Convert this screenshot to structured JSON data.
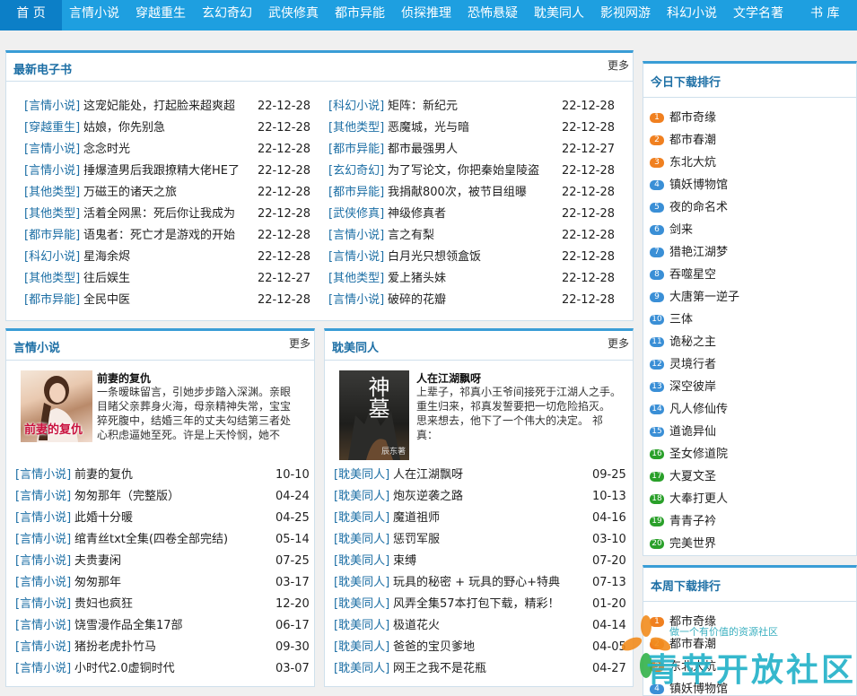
{
  "nav": {
    "items": [
      "首 页",
      "言情小说",
      "穿越重生",
      "玄幻奇幻",
      "武侠修真",
      "都市异能",
      "侦探推理",
      "恐怖悬疑",
      "耽美同人",
      "影视网游",
      "科幻小说",
      "文学名著",
      "书 库"
    ]
  },
  "latest": {
    "title": "最新电子书",
    "more": "更多",
    "left": [
      {
        "cat": "[言情小说]",
        "title": "这宠妃能处，打起脸来超爽超",
        "date": "22-12-28"
      },
      {
        "cat": "[穿越重生]",
        "title": "姑娘，你先别急",
        "date": "22-12-28"
      },
      {
        "cat": "[言情小说]",
        "title": "念念时光",
        "date": "22-12-28"
      },
      {
        "cat": "[言情小说]",
        "title": "捶爆渣男后我跟撩精大佬HE了",
        "date": "22-12-28"
      },
      {
        "cat": "[其他类型]",
        "title": "万磁王的诸天之旅",
        "date": "22-12-28"
      },
      {
        "cat": "[其他类型]",
        "title": "活着全网黑：死后你让我成为",
        "date": "22-12-28"
      },
      {
        "cat": "[都市异能]",
        "title": "语鬼者：死亡才是游戏的开始",
        "date": "22-12-28"
      },
      {
        "cat": "[科幻小说]",
        "title": "星海余烬",
        "date": "22-12-28"
      },
      {
        "cat": "[其他类型]",
        "title": "往后娱生",
        "date": "22-12-27"
      },
      {
        "cat": "[都市异能]",
        "title": "全民中医",
        "date": "22-12-28"
      }
    ],
    "right": [
      {
        "cat": "[科幻小说]",
        "title": "矩阵：新纪元",
        "date": "22-12-28"
      },
      {
        "cat": "[其他类型]",
        "title": "恶魔城，光与暗",
        "date": "22-12-28"
      },
      {
        "cat": "[都市异能]",
        "title": "都市最强男人",
        "date": "22-12-27"
      },
      {
        "cat": "[玄幻奇幻]",
        "title": "为了写论文，你把秦始皇陵盗",
        "date": "22-12-28"
      },
      {
        "cat": "[都市异能]",
        "title": "我捐献800次，被节目组曝",
        "date": "22-12-28"
      },
      {
        "cat": "[武侠修真]",
        "title": "神级修真者",
        "date": "22-12-28"
      },
      {
        "cat": "[言情小说]",
        "title": "言之有梨",
        "date": "22-12-28"
      },
      {
        "cat": "[言情小说]",
        "title": "白月光只想领盒饭",
        "date": "22-12-28"
      },
      {
        "cat": "[其他类型]",
        "title": "爱上猪头妹",
        "date": "22-12-28"
      },
      {
        "cat": "[言情小说]",
        "title": "破碎的花瓣",
        "date": "22-12-28"
      }
    ]
  },
  "romance": {
    "title": "言情小说",
    "more": "更多",
    "feature": {
      "cover_text": "前妻的复仇",
      "title": "前妻的复仇",
      "desc": "一条暧昧留言，引她步步踏入深渊。亲眼目睹父亲葬身火海，母亲精神失常，宝宝猝死腹中，结婚三年的丈夫勾结第三者处心积虑逼她至死。许是上天怜悯，她不"
    },
    "items": [
      {
        "cat": "[言情小说]",
        "title": "前妻的复仇",
        "date": "10-10"
      },
      {
        "cat": "[言情小说]",
        "title": "匆匆那年（完整版）",
        "date": "04-24"
      },
      {
        "cat": "[言情小说]",
        "title": "此婚十分暖",
        "date": "04-25"
      },
      {
        "cat": "[言情小说]",
        "title": "绾青丝txt全集(四卷全部完结)",
        "date": "05-14"
      },
      {
        "cat": "[言情小说]",
        "title": "夫贵妻闲",
        "date": "07-25"
      },
      {
        "cat": "[言情小说]",
        "title": "匆匆那年",
        "date": "03-17"
      },
      {
        "cat": "[言情小说]",
        "title": "贵妇也疯狂",
        "date": "12-20"
      },
      {
        "cat": "[言情小说]",
        "title": "饶雪漫作品全集17部",
        "date": "06-17"
      },
      {
        "cat": "[言情小说]",
        "title": "猪扮老虎扑竹马",
        "date": "09-30"
      },
      {
        "cat": "[言情小说]",
        "title": "小时代2.0虚铜时代",
        "date": "03-07"
      }
    ]
  },
  "danmei": {
    "title": "耽美同人",
    "more": "更多",
    "feature": {
      "cover_text": "神墓",
      "cover_sub": "辰东著",
      "title": "人在江湖飘呀",
      "desc": "上辈子，祁真小王爷间接死于江湖人之手。 重生归来，祁真发誓要把一切危险掐灭。 思来想去，他下了一个伟大的决定。 祁真："
    },
    "items": [
      {
        "cat": "[耽美同人]",
        "title": "人在江湖飘呀",
        "date": "09-25"
      },
      {
        "cat": "[耽美同人]",
        "title": "炮灰逆袭之路",
        "date": "10-13"
      },
      {
        "cat": "[耽美同人]",
        "title": "魔道祖师",
        "date": "04-16"
      },
      {
        "cat": "[耽美同人]",
        "title": "惩罚军服",
        "date": "03-10"
      },
      {
        "cat": "[耽美同人]",
        "title": "束缚",
        "date": "07-20"
      },
      {
        "cat": "[耽美同人]",
        "title": "玩具的秘密 + 玩具的野心+特典",
        "date": "07-13"
      },
      {
        "cat": "[耽美同人]",
        "title": "风弄全集57本打包下载，精彩！",
        "date": "01-20"
      },
      {
        "cat": "[耽美同人]",
        "title": "极道花火",
        "date": "04-14"
      },
      {
        "cat": "[耽美同人]",
        "title": "爸爸的宝贝爹地",
        "date": "04-05"
      },
      {
        "cat": "[耽美同人]",
        "title": "网王之我不是花瓶",
        "date": "04-27"
      }
    ]
  },
  "today_rank": {
    "title": "今日下载排行",
    "items": [
      "都市奇缘",
      "都市春潮",
      "东北大炕",
      "镇妖博物馆",
      "夜的命名术",
      "剑来",
      "猎艳江湖梦",
      "吞噬星空",
      "大唐第一逆子",
      "三体",
      "诡秘之主",
      "灵境行者",
      "深空彼岸",
      "凡人修仙传",
      "道诡异仙",
      "圣女修道院",
      "大夏文圣",
      "大奉打更人",
      "青青子衿",
      "完美世界"
    ]
  },
  "week_rank": {
    "title": "本周下载排行",
    "items": [
      "都市奇缘",
      "都市春潮",
      "东北大炕",
      "镇妖博物馆"
    ]
  },
  "watermark": {
    "slogan": "做一个有价值的资源社区",
    "name": "青苹开放社区"
  },
  "colors": {
    "nav": "#1e9fe0",
    "nav_home": "#0c7fc7",
    "accent": "#3a9dd6",
    "link": "#1d6fa5",
    "rank_top": "#f08020",
    "rank_mid": "#3a8fd6",
    "rank_low": "#2aa02a"
  }
}
